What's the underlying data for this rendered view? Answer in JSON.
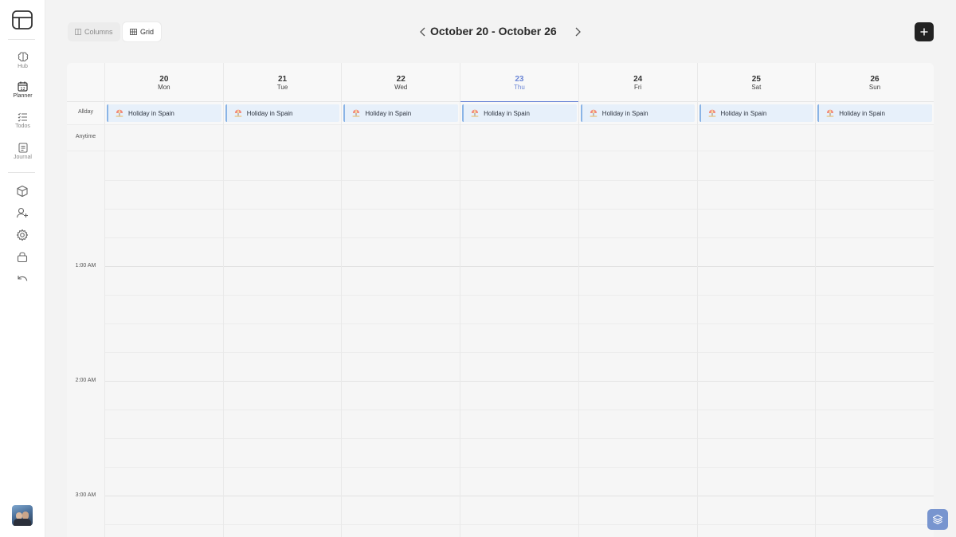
{
  "sidebar": {
    "items": [
      {
        "label": "Hub",
        "icon": "brain-icon"
      },
      {
        "label": "Planner",
        "icon": "calendar-icon"
      },
      {
        "label": "Todos",
        "icon": "checklist-icon"
      },
      {
        "label": "Journal",
        "icon": "journal-icon"
      }
    ],
    "tools": [
      "cube-icon",
      "add-user-icon",
      "gear-icon",
      "lock-icon",
      "undo-icon"
    ]
  },
  "toolbar": {
    "columns_label": "Columns",
    "grid_label": "Grid",
    "active_view": "Grid",
    "title": "October 20 - October 26"
  },
  "calendar": {
    "days": [
      {
        "num": "20",
        "name": "Mon",
        "today": false
      },
      {
        "num": "21",
        "name": "Tue",
        "today": false
      },
      {
        "num": "22",
        "name": "Wed",
        "today": false
      },
      {
        "num": "23",
        "name": "Thu",
        "today": true
      },
      {
        "num": "24",
        "name": "Fri",
        "today": false
      },
      {
        "num": "25",
        "name": "Sat",
        "today": false
      },
      {
        "num": "26",
        "name": "Sun",
        "today": false
      }
    ],
    "allday_label": "Allday",
    "anytime_label": "Anytime",
    "allday_event": "Holiday in Spain",
    "time_labels": [
      "1:00 AM",
      "2:00 AM",
      "3:00 AM"
    ]
  },
  "colors": {
    "accent": "#6b86d6",
    "event_bg": "#e7f0fa",
    "event_border": "#8ab4e6",
    "add_button": "#222222",
    "layers_button": "#7895cf"
  }
}
